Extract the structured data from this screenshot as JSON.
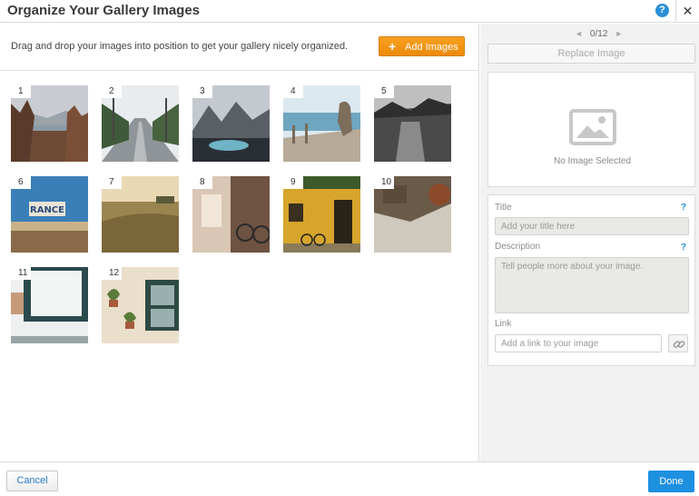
{
  "header": {
    "title": "Organize Your Gallery Images",
    "help": "?",
    "close": "✕"
  },
  "toolbar": {
    "instructions": "Drag and drop your images into position to get your gallery nicely organized.",
    "add_plus": "+",
    "add_label": "Add Images"
  },
  "gallery": {
    "items": [
      {
        "number": "1"
      },
      {
        "number": "2"
      },
      {
        "number": "3"
      },
      {
        "number": "4"
      },
      {
        "number": "5"
      },
      {
        "number": "6"
      },
      {
        "number": "7"
      },
      {
        "number": "8"
      },
      {
        "number": "9"
      },
      {
        "number": "10"
      },
      {
        "number": "11"
      },
      {
        "number": "12"
      }
    ],
    "sign_text": "RANCE"
  },
  "inspector": {
    "prev_arrow": "◄",
    "next_arrow": "►",
    "counter": "0/12",
    "replace_label": "Replace Image",
    "no_image": "No Image Selected",
    "title_label": "Title",
    "title_help": "?",
    "title_placeholder": "Add your title here",
    "description_label": "Description",
    "description_help": "?",
    "description_placeholder": "Tell people more about your image.",
    "link_label": "Link",
    "link_placeholder": "Add a link to your image"
  },
  "footer": {
    "cancel_label": "Cancel",
    "done_label": "Done"
  },
  "colors": {
    "accent_orange": "#f39a1a",
    "accent_blue": "#1e90e0"
  }
}
